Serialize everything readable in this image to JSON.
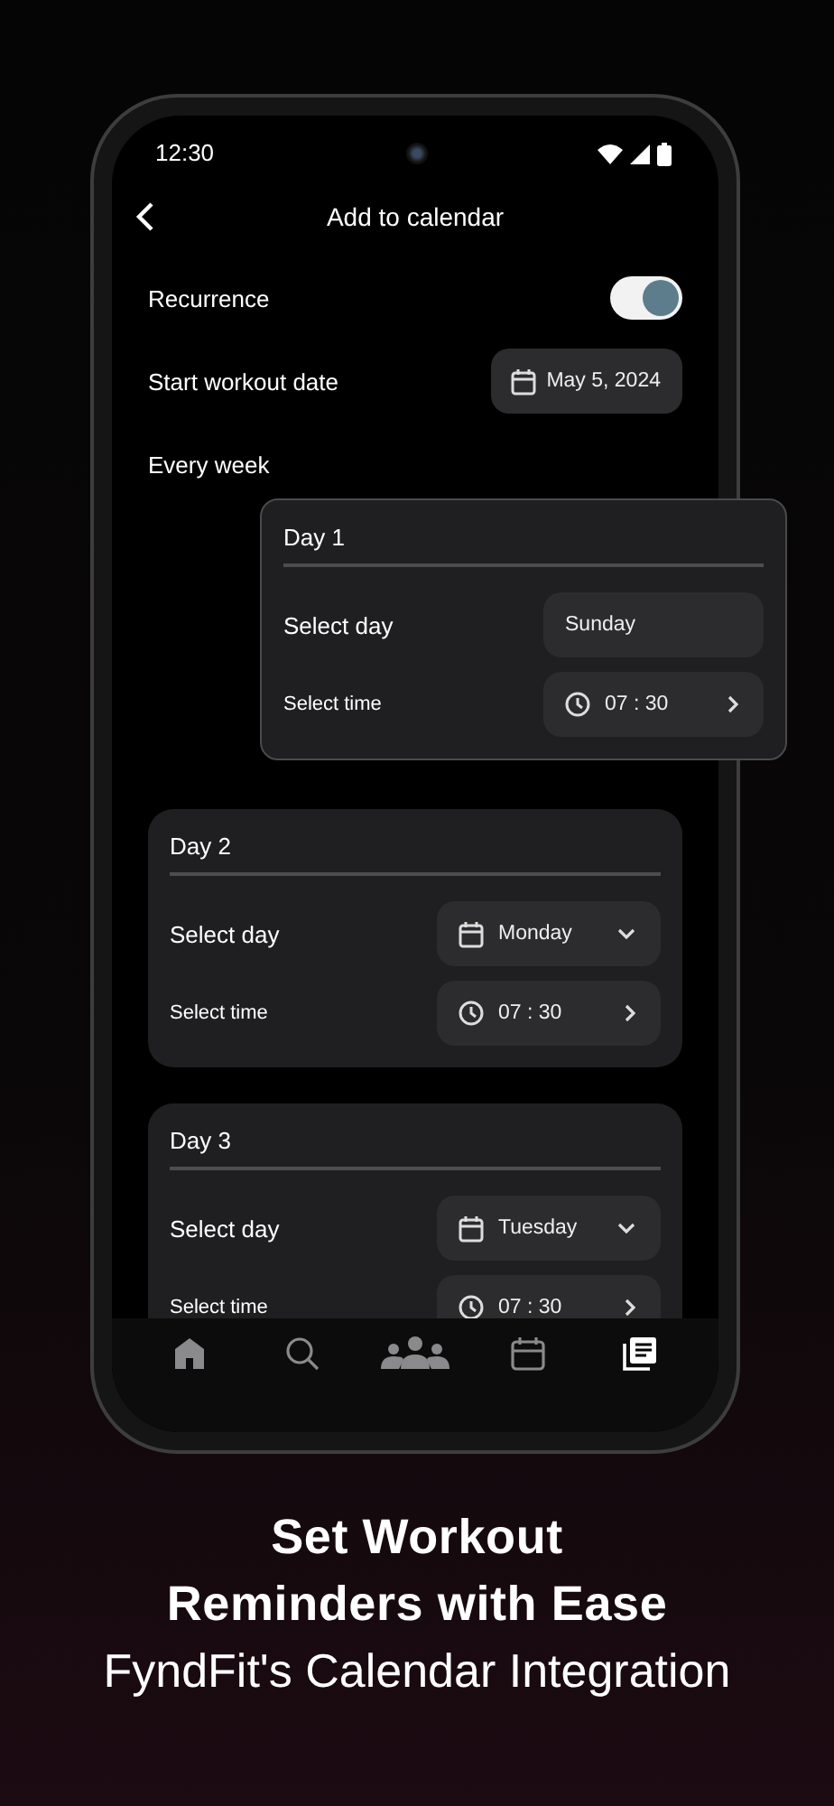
{
  "status_bar": {
    "time": "12:30"
  },
  "header": {
    "title": "Add to calendar"
  },
  "settings": {
    "recurrence": {
      "label": "Recurrence",
      "on": true
    },
    "start_date": {
      "label": "Start workout date",
      "value": "May 5, 2024"
    },
    "frequency": {
      "label": "Every week"
    }
  },
  "days": [
    {
      "kind": "popup",
      "title": "Day 1",
      "day_label": "Select day",
      "day_value": "Sunday",
      "time_label": "Select time",
      "time_value": "07 : 30"
    },
    {
      "kind": "card",
      "title": "Day 2",
      "day_label": "Select day",
      "day_value": "Monday",
      "time_label": "Select time",
      "time_value": "07 : 30"
    },
    {
      "kind": "card",
      "title": "Day 3",
      "day_label": "Select day",
      "day_value": "Tuesday",
      "time_label": "Select time",
      "time_value": "07 : 30"
    }
  ],
  "nav": [
    {
      "kind": "home",
      "selected": false
    },
    {
      "kind": "search",
      "selected": false
    },
    {
      "kind": "community",
      "selected": false
    },
    {
      "kind": "calendar",
      "selected": false
    },
    {
      "kind": "articles",
      "selected": true
    }
  ],
  "caption": {
    "title": "Set Workout Reminders with Ease",
    "subtitle": "FyndFit's Calendar Integration"
  }
}
